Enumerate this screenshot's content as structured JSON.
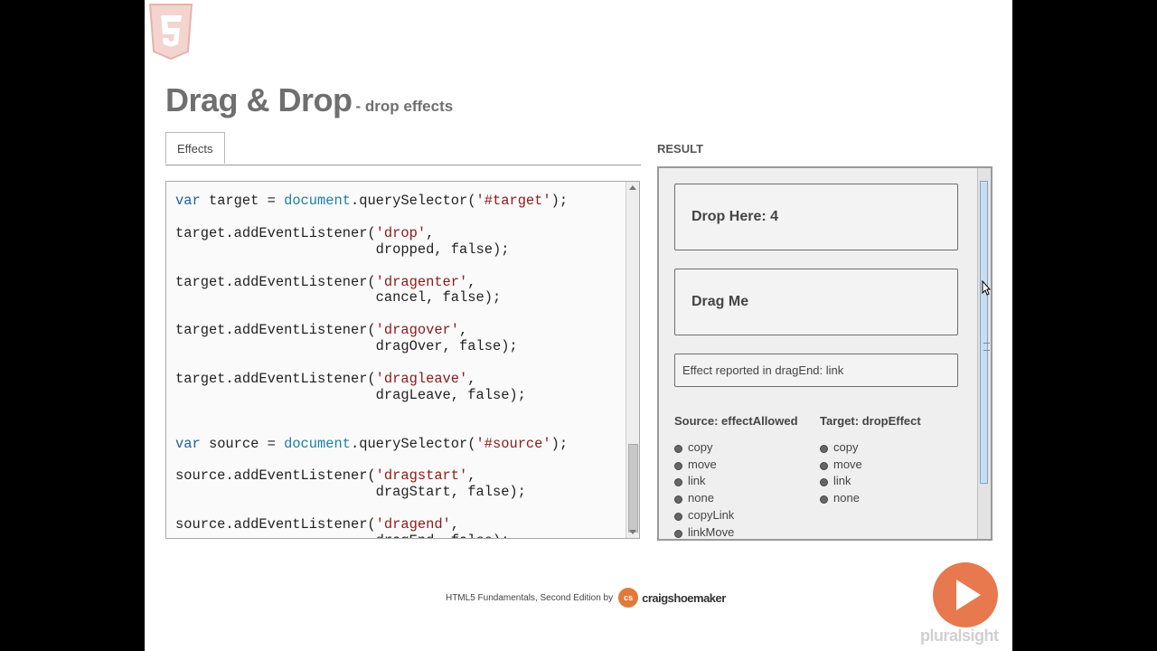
{
  "slide": {
    "title": "Drag & Drop",
    "subtitle": "- drop effects"
  },
  "tabs": [
    {
      "label": "Effects",
      "active": true
    }
  ],
  "result_label": "RESULT",
  "code_lines": [
    [
      {
        "t": "kw",
        "v": "var"
      },
      {
        "t": "",
        "v": " target = "
      },
      {
        "t": "obj",
        "v": "document"
      },
      {
        "t": "",
        "v": ".querySelector("
      },
      {
        "t": "str",
        "v": "'#target'"
      },
      {
        "t": "",
        "v": ");"
      }
    ],
    [],
    [
      {
        "t": "",
        "v": "target.addEventListener("
      },
      {
        "t": "str",
        "v": "'drop'"
      },
      {
        "t": "",
        "v": ","
      }
    ],
    [
      {
        "t": "",
        "v": "                        dropped, false);"
      }
    ],
    [],
    [
      {
        "t": "",
        "v": "target.addEventListener("
      },
      {
        "t": "str",
        "v": "'dragenter'"
      },
      {
        "t": "",
        "v": ","
      }
    ],
    [
      {
        "t": "",
        "v": "                        cancel, false);"
      }
    ],
    [],
    [
      {
        "t": "",
        "v": "target.addEventListener("
      },
      {
        "t": "str",
        "v": "'dragover'"
      },
      {
        "t": "",
        "v": ","
      }
    ],
    [
      {
        "t": "",
        "v": "                        dragOver, false);"
      }
    ],
    [],
    [
      {
        "t": "",
        "v": "target.addEventListener("
      },
      {
        "t": "str",
        "v": "'dragleave'"
      },
      {
        "t": "",
        "v": ","
      }
    ],
    [
      {
        "t": "",
        "v": "                        dragLeave, false);"
      }
    ],
    [],
    [],
    [
      {
        "t": "kw",
        "v": "var"
      },
      {
        "t": "",
        "v": " source = "
      },
      {
        "t": "obj",
        "v": "document"
      },
      {
        "t": "",
        "v": ".querySelector("
      },
      {
        "t": "str",
        "v": "'#source'"
      },
      {
        "t": "",
        "v": ");"
      }
    ],
    [],
    [
      {
        "t": "",
        "v": "source.addEventListener("
      },
      {
        "t": "str",
        "v": "'dragstart'"
      },
      {
        "t": "",
        "v": ","
      }
    ],
    [
      {
        "t": "",
        "v": "                        dragStart, false);"
      }
    ],
    [],
    [
      {
        "t": "",
        "v": "source.addEventListener("
      },
      {
        "t": "str",
        "v": "'dragend'"
      },
      {
        "t": "",
        "v": ","
      }
    ],
    [
      {
        "t": "",
        "v": "                        dragEnd, false);"
      }
    ]
  ],
  "result": {
    "drop_label": "Drop Here: 4",
    "drag_label": "Drag Me",
    "effect_text": "Effect reported in dragEnd: link",
    "source_title": "Source: effectAllowed",
    "target_title": "Target: dropEffect",
    "source_options": [
      "copy",
      "move",
      "link",
      "none",
      "copyLink",
      "linkMove"
    ],
    "target_options": [
      "copy",
      "move",
      "link",
      "none"
    ]
  },
  "footer": {
    "course": "HTML5 Fundamentals, Second Edition by",
    "logo_text": "cs",
    "author": "craigshoemaker",
    "brand": "pluralsight"
  },
  "colors": {
    "keyword": "#1d5fa3",
    "string": "#8b1a1a",
    "accent": "#e8784d"
  }
}
